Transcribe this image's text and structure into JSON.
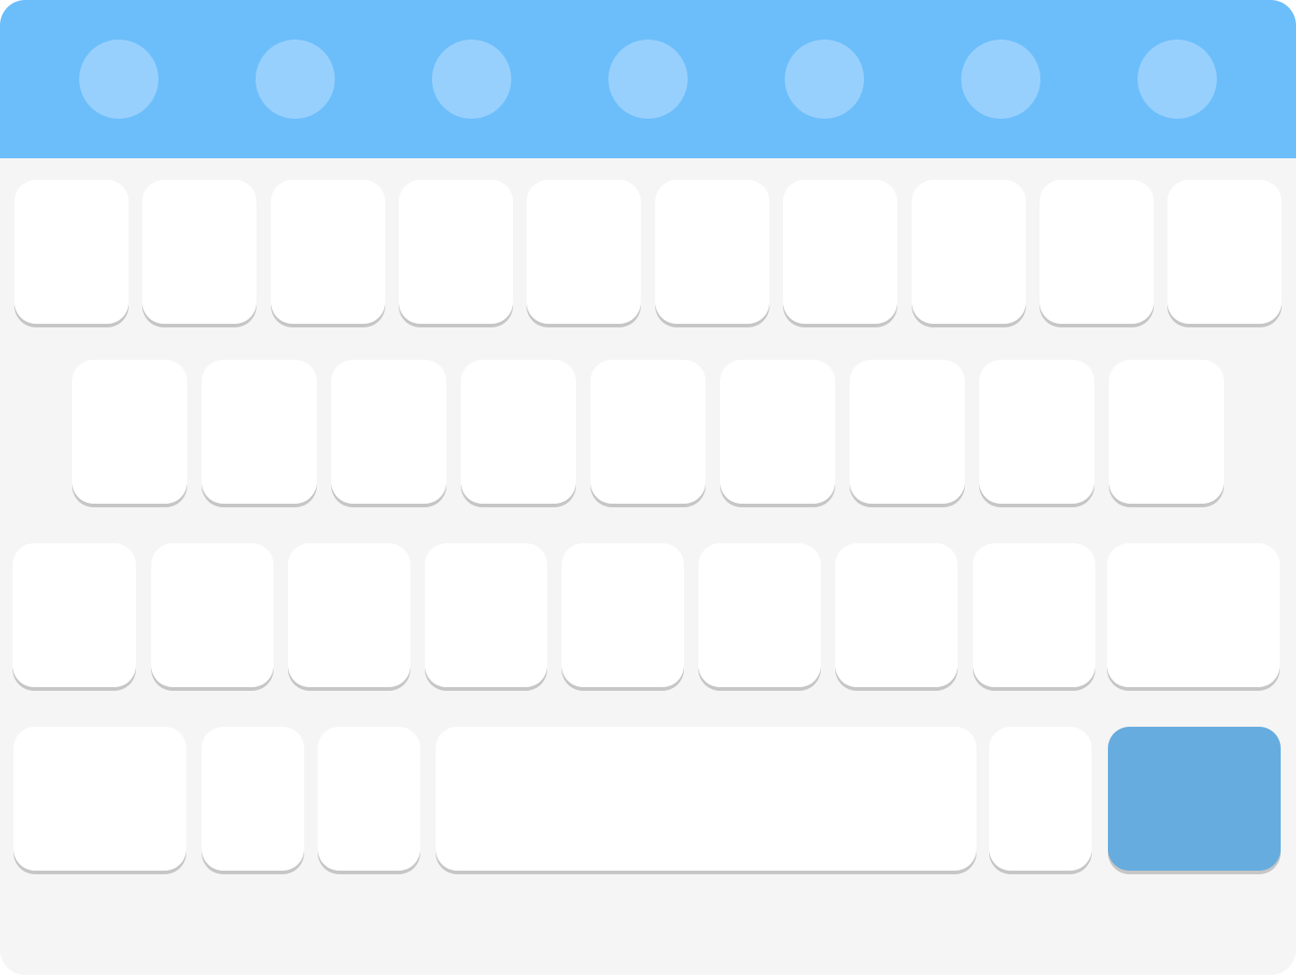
{
  "colors": {
    "background": "#f5f5f5",
    "suggestion_bar": "#6cbefa",
    "suggestion_dot": "#98d0fd",
    "key": "#ffffff",
    "key_shadow": "#c6c6c6",
    "action_key": "#66acdf"
  },
  "suggestion_bar": {
    "dot_count": 7,
    "dot_icon": "circle-placeholder-icon"
  },
  "rows": [
    {
      "name": "row-1",
      "key_count": 10,
      "keys": [
        "letter",
        "letter",
        "letter",
        "letter",
        "letter",
        "letter",
        "letter",
        "letter",
        "letter",
        "letter"
      ]
    },
    {
      "name": "row-2",
      "key_count": 9,
      "keys": [
        "letter",
        "letter",
        "letter",
        "letter",
        "letter",
        "letter",
        "letter",
        "letter",
        "letter"
      ]
    },
    {
      "name": "row-3",
      "key_count": 9,
      "keys": [
        "letter",
        "letter",
        "letter",
        "letter",
        "letter",
        "letter",
        "letter",
        "letter",
        "wide"
      ]
    },
    {
      "name": "row-4",
      "key_count": 6,
      "keys": [
        "modifier",
        "small",
        "small",
        "space",
        "small",
        "action"
      ]
    }
  ]
}
